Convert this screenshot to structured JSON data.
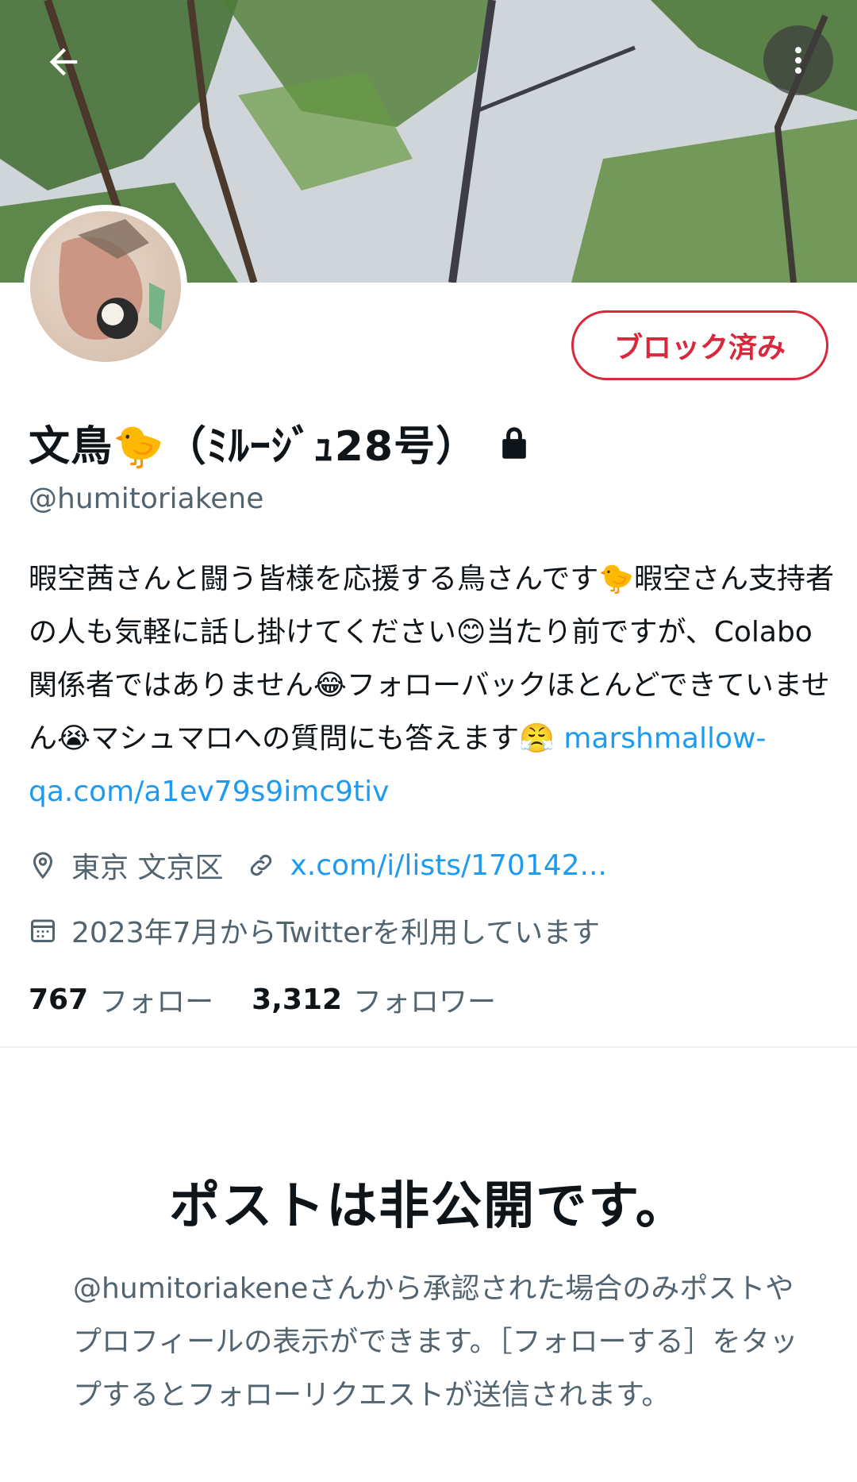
{
  "profile": {
    "display_name": "文鳥🐤（ﾐﾙｰｼﾞｭ28号）",
    "handle": "@humitoriakene",
    "bio_text": "暇空茜さんと闘う皆様を応援する鳥さんです🐤暇空さん支持者の人も気軽に話し掛けてください😊当たり前ですが、Colabo関係者ではありません😂フォローバックほとんどできていません😭マシュマロへの質問にも答えます😤 ",
    "bio_link": "marshmallow-qa.com/a1ev79s9imc9tiv",
    "location": "東京 文京区",
    "website": "x.com/i/lists/170142...",
    "joined": "2023年7月からTwitterを利用しています",
    "following_count": "767",
    "following_label": "フォロー",
    "followers_count": "3,312",
    "followers_label": "フォロワー"
  },
  "actions": {
    "blocked_label": "ブロック済み"
  },
  "icons": {
    "back": "arrow-left-icon",
    "more": "more-vertical-icon",
    "lock": "lock-icon",
    "location": "location-pin-icon",
    "link": "link-icon",
    "calendar": "calendar-icon"
  },
  "private_notice": {
    "title": "ポストは非公開です。",
    "description": "@humitoriakeneさんから承認された場合のみポストやプロフィールの表示ができます。［フォローする］をタップするとフォローリクエストが送信されます。"
  },
  "colors": {
    "accent": "#1d9bf0",
    "blocked": "#d9273b",
    "secondary_text": "#536471"
  }
}
